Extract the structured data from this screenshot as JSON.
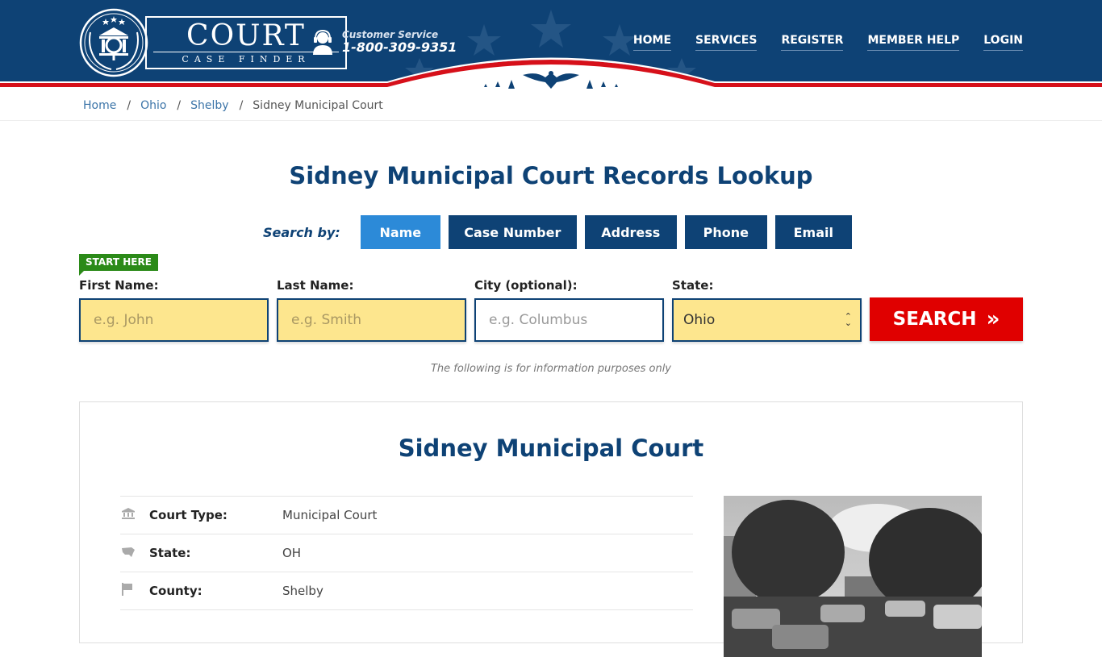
{
  "header": {
    "logo": {
      "title": "COURT",
      "subtitle": "CASE FINDER"
    },
    "customer_service": {
      "label": "Customer Service",
      "phone": "1-800-309-9351"
    },
    "nav": [
      {
        "label": "HOME"
      },
      {
        "label": "SERVICES"
      },
      {
        "label": "REGISTER"
      },
      {
        "label": "MEMBER HELP"
      },
      {
        "label": "LOGIN"
      }
    ],
    "colors": {
      "primary": "#0e4275",
      "accent_red": "#e00000"
    }
  },
  "breadcrumb": {
    "items": [
      {
        "label": "Home"
      },
      {
        "label": "Ohio"
      },
      {
        "label": "Shelby"
      }
    ],
    "current": "Sidney Municipal Court",
    "separator": "/"
  },
  "page_title": "Sidney Municipal Court Records Lookup",
  "search": {
    "by_label": "Search by:",
    "tabs": [
      {
        "label": "Name",
        "active": true
      },
      {
        "label": "Case Number",
        "active": false
      },
      {
        "label": "Address",
        "active": false
      },
      {
        "label": "Phone",
        "active": false
      },
      {
        "label": "Email",
        "active": false
      }
    ],
    "start_here": "START HERE",
    "fields": {
      "first_name": {
        "label": "First Name:",
        "placeholder": "e.g. John",
        "value": ""
      },
      "last_name": {
        "label": "Last Name:",
        "placeholder": "e.g. Smith",
        "value": ""
      },
      "city": {
        "label": "City (optional):",
        "placeholder": "e.g.  Columbus",
        "value": ""
      },
      "state": {
        "label": "State:",
        "value": "Ohio"
      }
    },
    "button_label": "SEARCH",
    "button_icon": "»",
    "disclaimer": "The following is for information purposes only"
  },
  "court": {
    "title": "Sidney Municipal Court",
    "details": [
      {
        "icon": "courthouse-icon",
        "label": "Court Type:",
        "value": "Municipal Court"
      },
      {
        "icon": "us-map-icon",
        "label": "State:",
        "value": "OH"
      },
      {
        "icon": "flag-icon",
        "label": "County:",
        "value": "Shelby"
      }
    ]
  }
}
